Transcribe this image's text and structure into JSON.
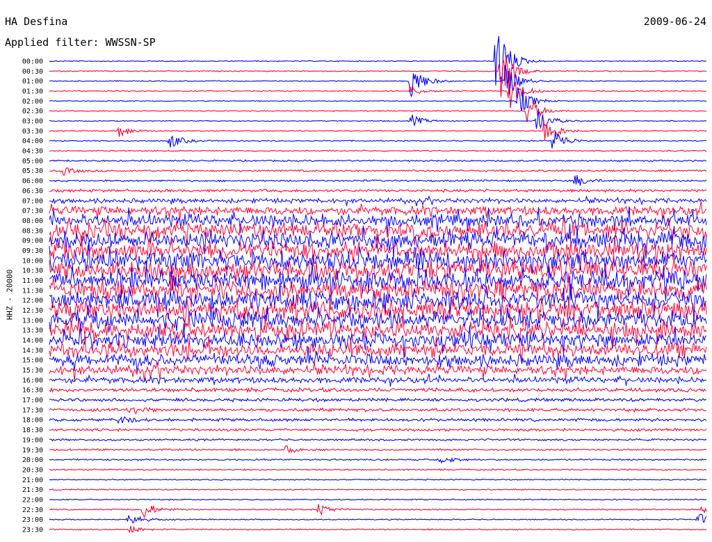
{
  "header": {
    "station": "HA Desfina",
    "filter": "Applied filter: WWSSN-SP",
    "date": "2009-06-24",
    "channel": "HHZ - 20000"
  },
  "colors": {
    "trace_a": "#0000ff",
    "trace_b": "#ff0033"
  },
  "chart_data": {
    "type": "line",
    "title": "HA Desfina",
    "subtitle": "Applied filter: WWSSN-SP",
    "date": "2009-06-24",
    "ylabel": "HHZ - 20000",
    "row_labels": [
      "00:00",
      "00:30",
      "01:00",
      "01:30",
      "02:00",
      "02:30",
      "03:00",
      "03:30",
      "04:00",
      "04:30",
      "05:00",
      "05:30",
      "06:00",
      "06:30",
      "07:00",
      "07:30",
      "08:00",
      "08:30",
      "09:00",
      "09:30",
      "10:00",
      "10:30",
      "11:00",
      "11:30",
      "12:00",
      "12:30",
      "13:00",
      "13:30",
      "14:00",
      "14:30",
      "15:00",
      "15:30",
      "16:00",
      "16:30",
      "17:00",
      "17:30",
      "18:00",
      "18:30",
      "19:00",
      "19:30",
      "20:00",
      "20:30",
      "21:00",
      "21:30",
      "22:00",
      "22:30",
      "23:00",
      "23:30"
    ],
    "x_minutes": [
      0,
      30
    ],
    "noise_level": [
      0.5,
      0.5,
      0.5,
      0.5,
      0.5,
      0.5,
      0.5,
      0.5,
      0.6,
      0.6,
      0.8,
      0.9,
      0.9,
      1.4,
      2.2,
      4.5,
      6.5,
      7.5,
      8,
      8.5,
      9,
      9,
      9,
      9,
      9,
      9,
      8.5,
      8,
      7.5,
      7,
      6,
      4.5,
      3,
      2,
      1.6,
      1.6,
      1.5,
      1.3,
      1.0,
      0.9,
      0.8,
      0.7,
      0.6,
      0.6,
      0.6,
      0.6,
      0.6,
      0.6
    ],
    "events": [
      {
        "row": 0,
        "minute": 20.4,
        "amp": 70
      },
      {
        "row": 1,
        "minute": 20.6,
        "amp": 40
      },
      {
        "row": 2,
        "minute": 20.8,
        "amp": 30
      },
      {
        "row": 3,
        "minute": 21.0,
        "amp": 30
      },
      {
        "row": 4,
        "minute": 21.4,
        "amp": 25
      },
      {
        "row": 5,
        "minute": 21.8,
        "amp": 25
      },
      {
        "row": 6,
        "minute": 22.2,
        "amp": 25
      },
      {
        "row": 7,
        "minute": 22.6,
        "amp": 25
      },
      {
        "row": 8,
        "minute": 23.0,
        "amp": 20
      },
      {
        "row": 2,
        "minute": 16.5,
        "amp": 30
      },
      {
        "row": 3,
        "minute": 16.5,
        "amp": 8
      },
      {
        "row": 6,
        "minute": 16.5,
        "amp": 10
      },
      {
        "row": 7,
        "minute": 3.2,
        "amp": 10
      },
      {
        "row": 8,
        "minute": 5.5,
        "amp": 12
      },
      {
        "row": 11,
        "minute": 0.6,
        "amp": 6
      },
      {
        "row": 12,
        "minute": 24.0,
        "amp": 10
      },
      {
        "row": 35,
        "minute": 3.6,
        "amp": 10
      },
      {
        "row": 36,
        "minute": 3.2,
        "amp": 6
      },
      {
        "row": 39,
        "minute": 10.8,
        "amp": 6
      },
      {
        "row": 40,
        "minute": 17.8,
        "amp": 7
      },
      {
        "row": 45,
        "minute": 4.3,
        "amp": 14
      },
      {
        "row": 45,
        "minute": 12.3,
        "amp": 10
      },
      {
        "row": 46,
        "minute": 3.6,
        "amp": 11
      },
      {
        "row": 46,
        "minute": 29.6,
        "amp": 10
      },
      {
        "row": 47,
        "minute": 3.7,
        "amp": 6
      },
      {
        "row": 45,
        "minute": 29.8,
        "amp": 8
      }
    ],
    "grid": false
  }
}
